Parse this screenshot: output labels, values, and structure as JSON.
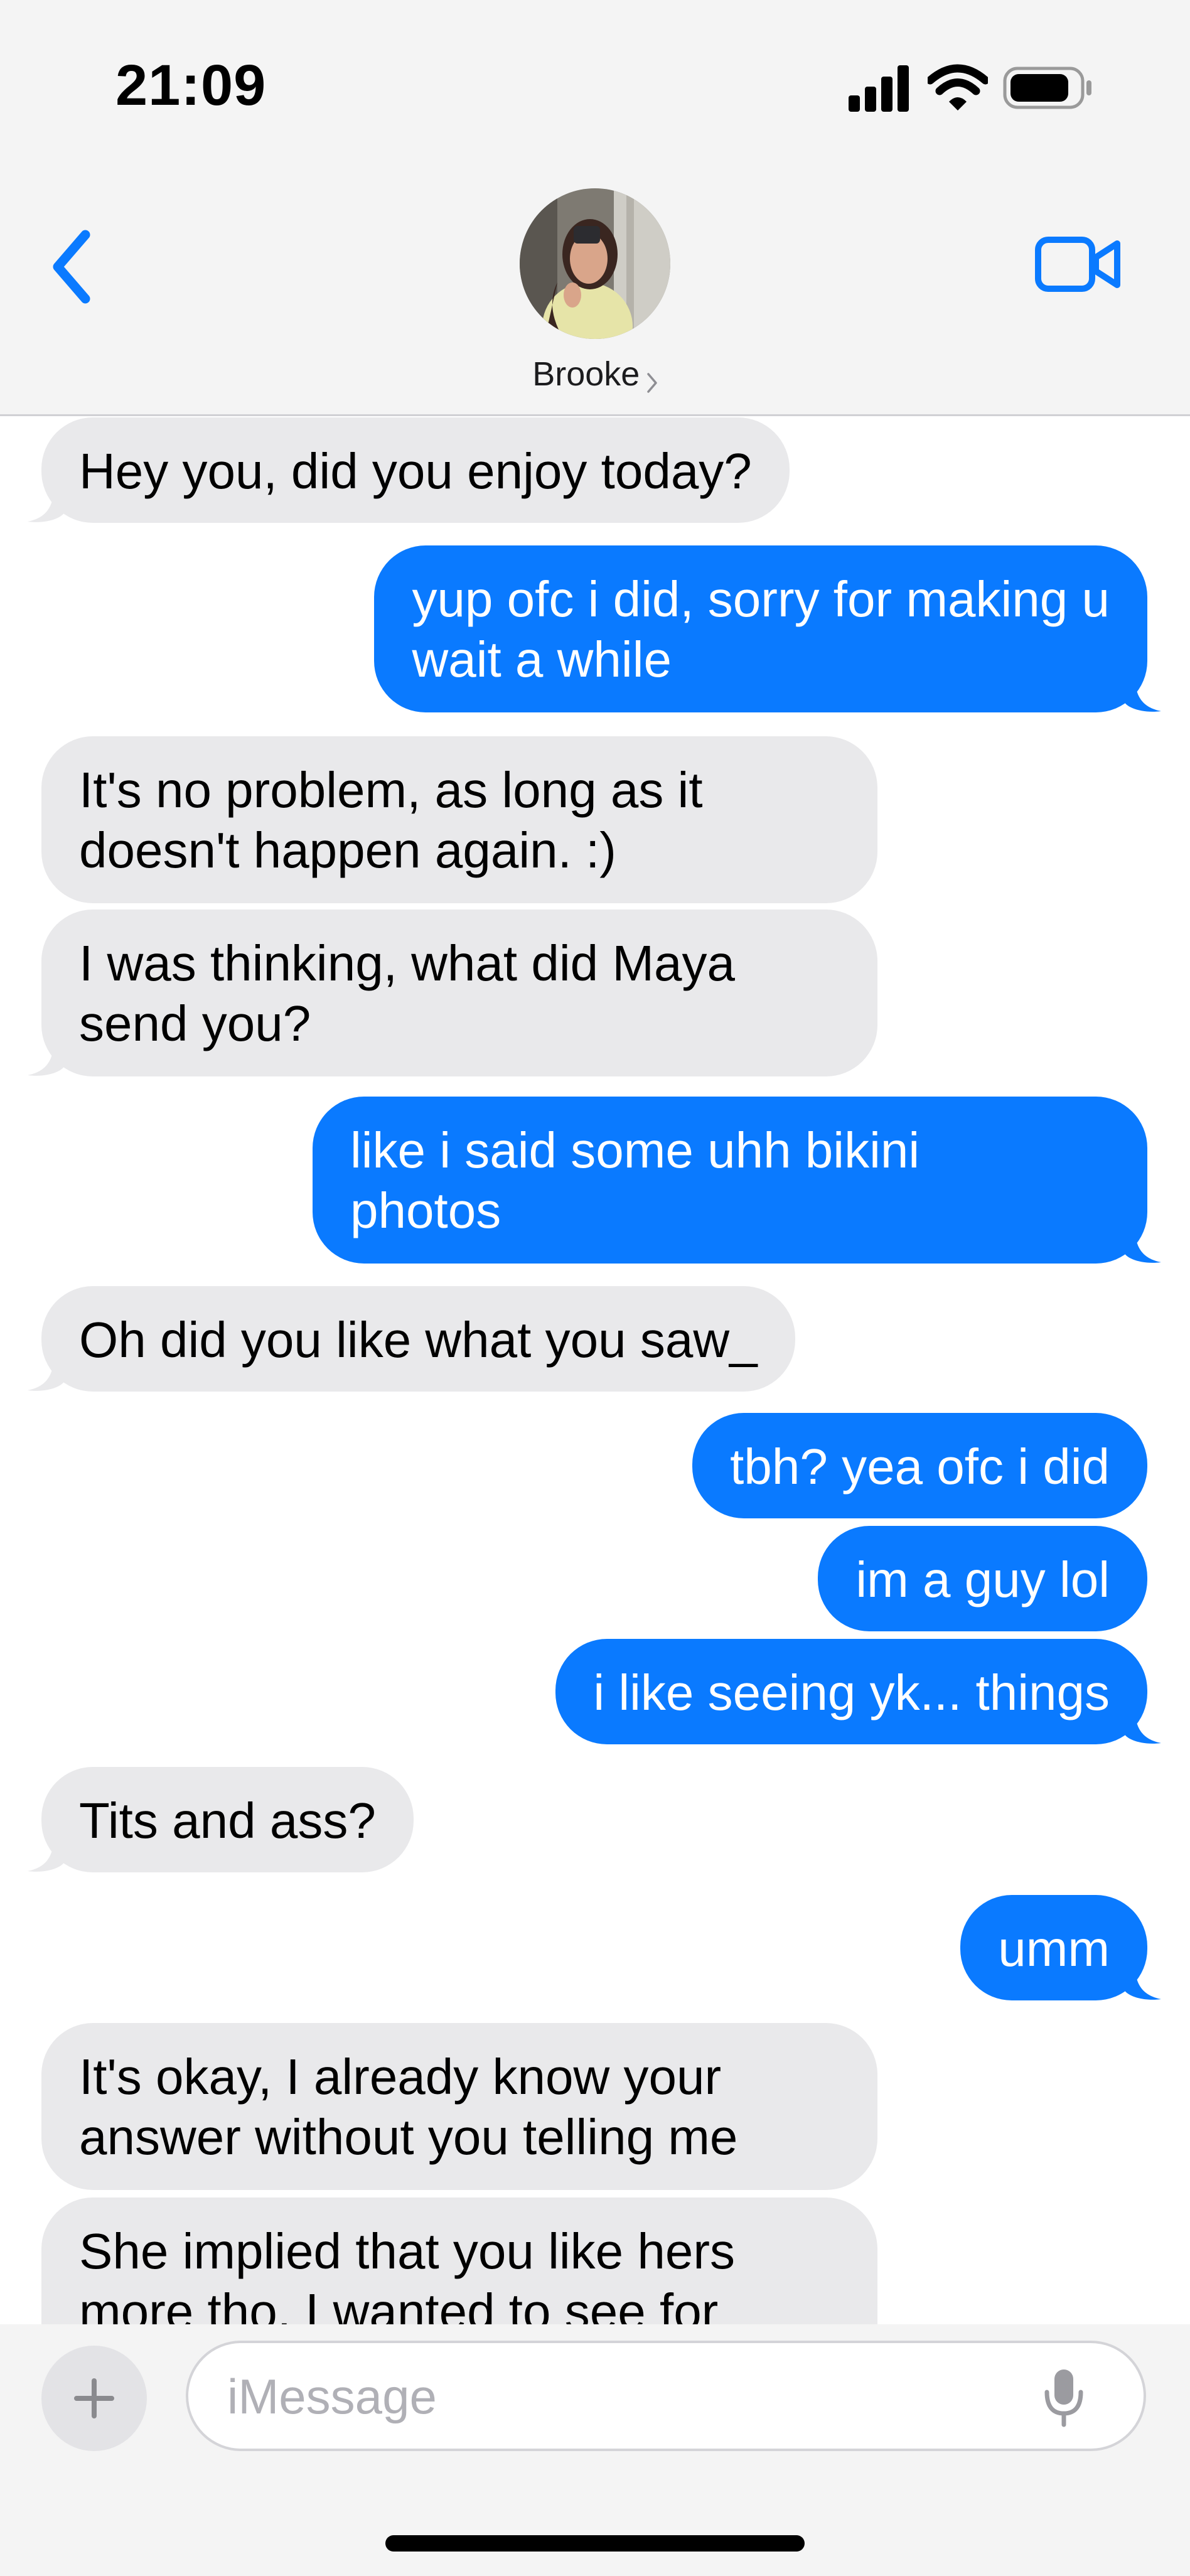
{
  "status_bar": {
    "time": "21:09",
    "icons": [
      "signal-icon",
      "wifi-icon",
      "battery-icon"
    ]
  },
  "header": {
    "contact_name": "Brooke",
    "back_icon": "chevron-left-icon",
    "call_icon": "video-camera-icon",
    "avatar": "contact-photo"
  },
  "colors": {
    "sent": "#0a7aff",
    "received": "#e9e9eb",
    "accent": "#0a7aff"
  },
  "messages": [
    {
      "from": "contact",
      "text": "Hey you, did you enjoy today?"
    },
    {
      "from": "me",
      "text": "yup ofc i did, sorry for making u\nwait a while"
    },
    {
      "from": "contact",
      "text": "It's no problem, as long as it\ndoesn't happen again. :)"
    },
    {
      "from": "contact",
      "text": "I was thinking, what did Maya\nsend you?"
    },
    {
      "from": "me",
      "text": "like i said some uhh bikini\nphotos"
    },
    {
      "from": "contact",
      "text": "Oh did you like what you saw_"
    },
    {
      "from": "me",
      "text": "tbh? yea ofc i did"
    },
    {
      "from": "me",
      "text": "im a guy lol"
    },
    {
      "from": "me",
      "text": "i like seeing yk... things"
    },
    {
      "from": "contact",
      "text": "Tits and ass?"
    },
    {
      "from": "me",
      "text": "umm"
    },
    {
      "from": "contact",
      "text": "It's okay, I already know your\nanswer without you telling me"
    },
    {
      "from": "contact",
      "text": "She implied that you like hers\nmore tho. I wanted to see for"
    }
  ],
  "composer": {
    "placeholder": "iMessage",
    "value": "",
    "add_icon": "plus-icon",
    "mic_icon": "microphone-icon"
  }
}
